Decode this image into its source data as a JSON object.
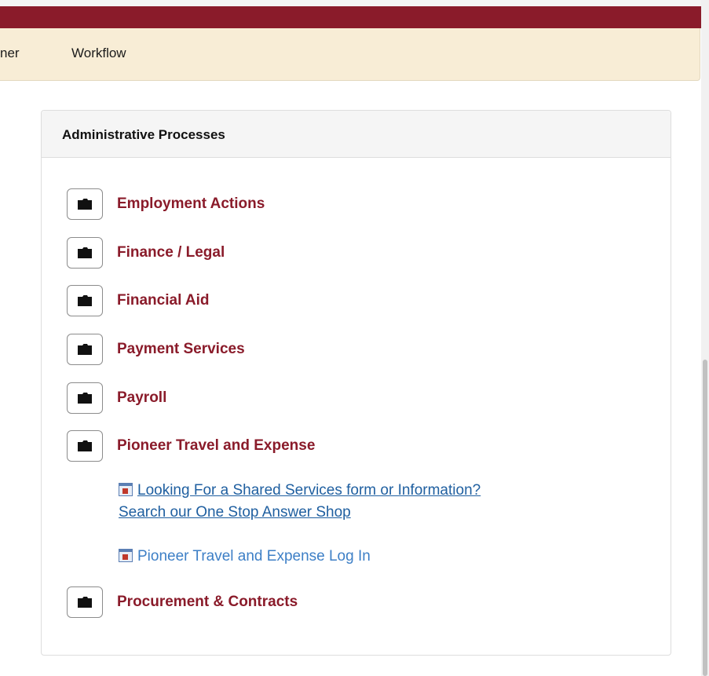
{
  "nav": {
    "partial_label": "ner",
    "workflow_label": "Workflow"
  },
  "panel": {
    "title": "Administrative Processes",
    "folders": [
      {
        "label": "Employment Actions"
      },
      {
        "label": "Finance / Legal"
      },
      {
        "label": "Financial Aid"
      },
      {
        "label": "Payment Services"
      },
      {
        "label": "Payroll"
      },
      {
        "label": "Pioneer Travel and Expense"
      },
      {
        "label": "Procurement & Contracts"
      }
    ],
    "sublinks": {
      "shared_services_line1": "Looking For a Shared Services form or Information?",
      "shared_services_line2": "Search our One Stop Answer Shop",
      "travel_login": "Pioneer Travel and Expense Log In"
    }
  },
  "icons": {
    "folder": "folder-icon",
    "link": "form-link-icon"
  },
  "colors": {
    "brand": "#8a1b2a",
    "nav_bg": "#f8edd6",
    "link": "#1f5fa0"
  }
}
